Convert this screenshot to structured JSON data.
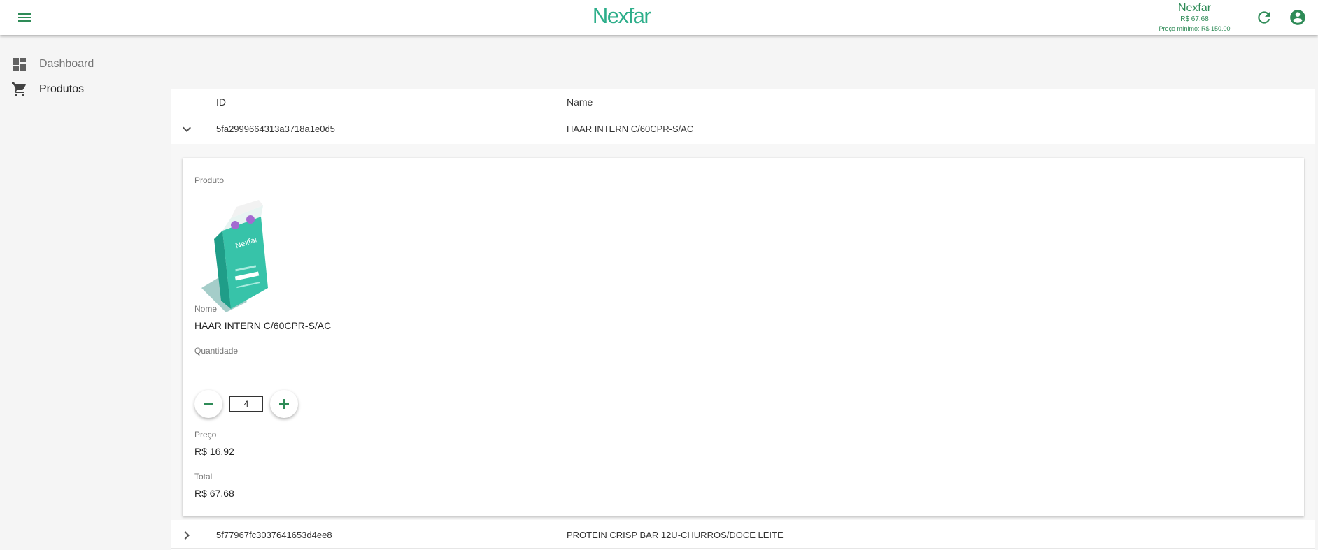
{
  "header": {
    "logo_text": "Nexfar",
    "account": {
      "name": "Nexfar",
      "balance": "R$ 67,68",
      "minimum": "Preço mínimo: R$ 150.00"
    },
    "icons": {
      "menu": "menu-icon",
      "refresh": "refresh-icon",
      "account": "account-circle-icon"
    },
    "brand_color": "#2dae8a",
    "accent_color": "#2e8b57"
  },
  "sidebar": {
    "items": [
      {
        "label": "Dashboard",
        "icon": "dashboard-icon"
      },
      {
        "label": "Produtos",
        "icon": "shopping-cart-icon"
      }
    ]
  },
  "table": {
    "columns": {
      "id": "ID",
      "name": "Name"
    },
    "rows": [
      {
        "id": "5fa2999664313a3718a1e0d5",
        "name": "HAAR INTERN C/60CPR-S/AC",
        "expanded": true
      },
      {
        "id": "5f77967fc3037641653d4ee8",
        "name": "PROTEIN CRISP BAR 12U-CHURROS/DOCE LEITE",
        "expanded": false
      }
    ]
  },
  "detail": {
    "product_label": "Produto",
    "name_label": "Nome",
    "name_value": "HAAR INTERN C/60CPR-S/AC",
    "quantity_label": "Quantidade",
    "quantity_value": "4",
    "price_label": "Preço",
    "price_value": "R$ 16,92",
    "total_label": "Total",
    "total_value": "R$ 67,68",
    "image_box_text": "Nexfar"
  }
}
